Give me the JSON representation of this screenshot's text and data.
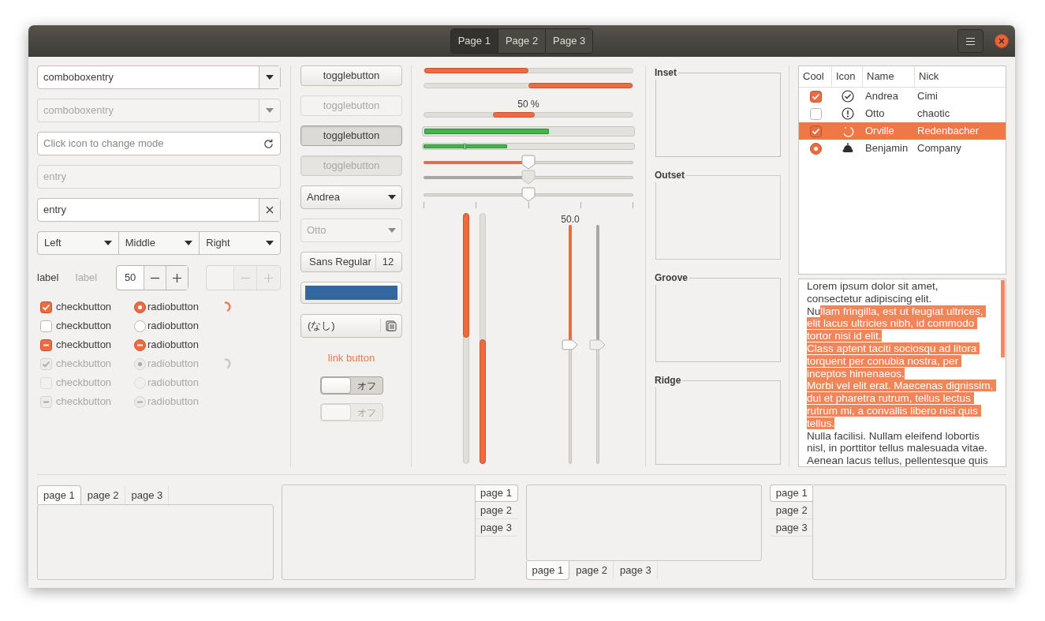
{
  "header": {
    "tabs": [
      {
        "label": "Page 1",
        "selected": true
      },
      {
        "label": "Page 2",
        "selected": false
      },
      {
        "label": "Page 3",
        "selected": false
      }
    ]
  },
  "entries": [
    {
      "kind": "combo",
      "value": "comboboxentry",
      "disabled": false
    },
    {
      "kind": "combo",
      "value": "comboboxentry",
      "disabled": true
    },
    {
      "kind": "icon",
      "placeholder": "Click icon to change mode",
      "disabled": false
    },
    {
      "kind": "plain",
      "value": "entry",
      "disabled": true
    },
    {
      "kind": "clear",
      "value": "entry",
      "disabled": false
    }
  ],
  "linked_combos": [
    "Left",
    "Middle",
    "Right"
  ],
  "labels": [
    {
      "text": "label",
      "disabled": false
    },
    {
      "text": "label",
      "disabled": true
    }
  ],
  "spins": [
    {
      "value": "50",
      "disabled": false
    },
    {
      "disabled": true
    }
  ],
  "check_rows": [
    {
      "check_label": "checkbutton",
      "checked": true,
      "inconsistent": false,
      "radio_label": "radiobutton",
      "radio_checked": true,
      "radio_inconsistent": false,
      "spinner_active": true,
      "disabled": false
    },
    {
      "check_label": "checkbutton",
      "checked": false,
      "inconsistent": false,
      "radio_label": "radiobutton",
      "radio_checked": false,
      "radio_inconsistent": false,
      "disabled": false
    },
    {
      "check_label": "checkbutton",
      "inconsistent": true,
      "radio_label": "radiobutton",
      "radio_inconsistent": true,
      "disabled": false
    },
    {
      "check_label": "checkbutton",
      "checked": true,
      "inconsistent": false,
      "radio_label": "radiobutton",
      "radio_checked": true,
      "radio_inconsistent": false,
      "spinner_active": false,
      "disabled": true
    },
    {
      "check_label": "checkbutton",
      "checked": false,
      "inconsistent": false,
      "radio_label": "radiobutton",
      "radio_checked": false,
      "radio_inconsistent": false,
      "disabled": true
    },
    {
      "check_label": "checkbutton",
      "inconsistent": true,
      "radio_label": "radiobutton",
      "radio_inconsistent": true,
      "disabled": true
    }
  ],
  "toggles": [
    {
      "label": "togglebutton",
      "pressed": false,
      "disabled": false
    },
    {
      "label": "togglebutton",
      "pressed": false,
      "disabled": true
    },
    {
      "label": "togglebutton",
      "pressed": true,
      "disabled": false
    },
    {
      "label": "togglebutton",
      "pressed": true,
      "disabled": true
    }
  ],
  "combos": [
    {
      "value": "Andrea",
      "disabled": false
    },
    {
      "value": "Otto",
      "disabled": true
    }
  ],
  "font_button": {
    "name": "Sans Regular",
    "size": "12"
  },
  "file_button": {
    "label": "(なし)"
  },
  "link_button": "link button",
  "switches": [
    {
      "label": "オフ",
      "on": false,
      "disabled": false
    },
    {
      "label": "オフ",
      "on": false,
      "disabled": true
    }
  ],
  "progress_bars": [
    {
      "kind": "normal",
      "level": 0.5
    },
    {
      "kind": "inverted",
      "level": 0.5
    },
    {
      "kind": "pulse",
      "text": "50 %"
    }
  ],
  "level_bars": [
    {
      "kind": "continuous",
      "level": 0.6
    },
    {
      "kind": "discrete",
      "level": 0.4
    }
  ],
  "hscales": [
    {
      "kind": "plain",
      "level": 0.5,
      "highlight": true,
      "disabled": false
    },
    {
      "kind": "plain",
      "level": 0.5,
      "highlight": true,
      "disabled": true
    },
    {
      "kind": "marks",
      "level": 0.5,
      "highlight": false,
      "disabled": false
    }
  ],
  "vprogress": [
    {
      "level": 0.5,
      "inverted": false
    },
    {
      "level": 0.5,
      "inverted": true
    }
  ],
  "vscales": [
    {
      "level": 0.5,
      "value_text": "50.0",
      "disabled": false
    },
    {
      "level": 0.5,
      "disabled": true
    }
  ],
  "frames": [
    {
      "label": "Inset",
      "kind": "inset"
    },
    {
      "label": "Outset",
      "kind": "outset"
    },
    {
      "label": "Groove",
      "kind": "groove"
    },
    {
      "label": "Ridge",
      "kind": "ridge"
    }
  ],
  "tree": {
    "columns": [
      "Cool",
      "Icon",
      "Name",
      "Nick"
    ],
    "rows": [
      {
        "kind": "check",
        "checked": true,
        "name": "Andrea",
        "nick": "Cimi",
        "selected": false
      },
      {
        "kind": "check",
        "checked": false,
        "name": "Otto",
        "nick": "chaotic",
        "selected": false
      },
      {
        "kind": "check",
        "checked": true,
        "name": "Orville",
        "nick": "Redenbacher",
        "selected": true
      },
      {
        "kind": "radio",
        "checked": true,
        "name": "Benjamin",
        "nick": "Company",
        "selected": false
      }
    ]
  },
  "text_view": {
    "before": "Lorem ipsum dolor sit amet, consectetur adipiscing elit.\nNu",
    "selected": "llam fringilla, est ut feugiat ultrices, elit lacus ultricies nibh, id commodo tortor nisi id elit.\nClass aptent taciti sociosqu ad litora torquent per conubia nostra, per inceptos himenaeos.\nMorbi vel elit erat. Maecenas dignissim, dui et pharetra rutrum, tellus lectus rutrum mi, a convallis libero nisi quis tellus.",
    "after": "\nNulla facilisi. Nullam eleifend lobortis nisl, in porttitor tellus malesuada vitae.\nAenean lacus tellus, pellentesque quis"
  },
  "notebooks": [
    {
      "kind": "top",
      "tabs": [
        {
          "label": "page 1",
          "selected": true
        },
        {
          "label": "page 2",
          "selected": false
        },
        {
          "label": "page 3",
          "selected": false
        }
      ]
    },
    {
      "kind": "right",
      "tabs": [
        {
          "label": "page 1",
          "selected": true
        },
        {
          "label": "page 2",
          "selected": false
        },
        {
          "label": "page 3",
          "selected": false
        }
      ]
    },
    {
      "kind": "bottom",
      "tabs": [
        {
          "label": "page 1",
          "selected": true
        },
        {
          "label": "page 2",
          "selected": false
        },
        {
          "label": "page 3",
          "selected": false
        }
      ]
    },
    {
      "kind": "left",
      "tabs": [
        {
          "label": "page 1",
          "selected": true
        },
        {
          "label": "page 2",
          "selected": false
        },
        {
          "label": "page 3",
          "selected": false
        }
      ]
    }
  ]
}
